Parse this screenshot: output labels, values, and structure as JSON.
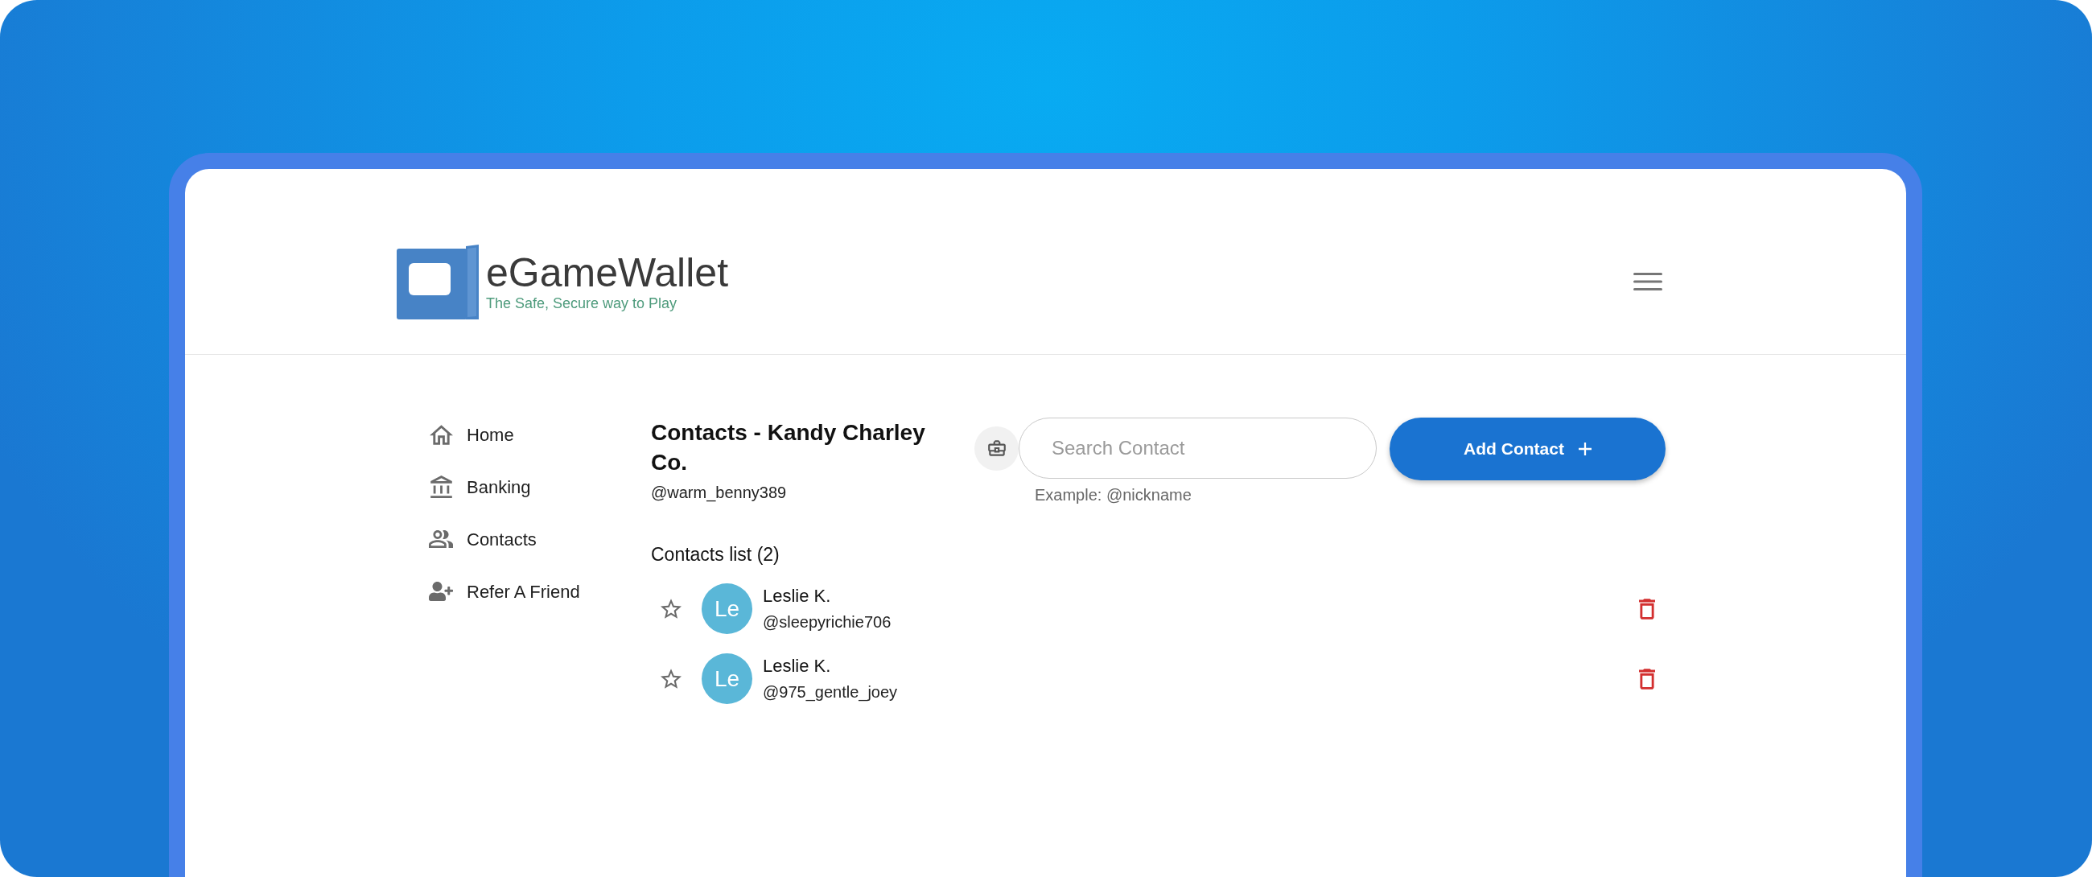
{
  "brand": {
    "name": "eGameWallet",
    "tagline": "The Safe, Secure way to Play"
  },
  "sidebar": {
    "items": [
      {
        "label": "Home"
      },
      {
        "label": "Banking"
      },
      {
        "label": "Contacts"
      },
      {
        "label": "Refer A Friend"
      }
    ]
  },
  "page": {
    "title": "Contacts - Kandy Charley Co.",
    "handle": "@warm_benny389"
  },
  "search": {
    "placeholder": "Search Contact",
    "hint": "Example: @nickname"
  },
  "add_button": {
    "label": "Add Contact"
  },
  "contacts": {
    "heading": "Contacts list (2)",
    "items": [
      {
        "initials": "Le",
        "name": "Leslie K.",
        "handle": "@sleepyrichie706",
        "favorite": false
      },
      {
        "initials": "Le",
        "name": "Leslie K.",
        "handle": "@975_gentle_joey",
        "favorite": false
      }
    ]
  }
}
